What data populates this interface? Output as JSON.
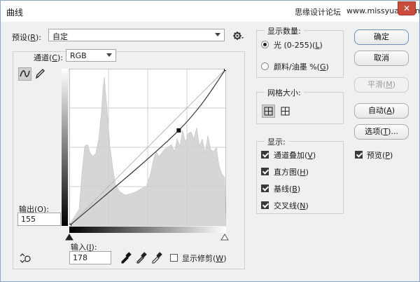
{
  "window": {
    "title": "曲线",
    "close_glyph": "✕"
  },
  "watermark": {
    "site_cn": "思缘设计论坛",
    "site_url": "www.missyuan.com"
  },
  "preset": {
    "label": "预设(",
    "label_key": "R",
    "label_end": "):",
    "value": "自定",
    "gear_icon": "gear-icon"
  },
  "channel": {
    "label": "通道(",
    "label_key": "C",
    "label_end": "):",
    "value": "RGB"
  },
  "output": {
    "label": "输出(",
    "label_key": "O",
    "label_end": "):",
    "value": "155"
  },
  "input": {
    "label": "输入(",
    "label_key": "I",
    "label_end": "):",
    "value": "178"
  },
  "show_clipping": {
    "label": "显示修剪(",
    "label_key": "W",
    "label_end": ")",
    "checked": false
  },
  "show_amount": {
    "title": "显示数量:",
    "options": [
      {
        "label": "光 (0-255)(",
        "key": "L",
        "end": ")",
        "selected": true
      },
      {
        "label": "颜料/油墨 %(",
        "key": "G",
        "end": ")",
        "selected": false
      }
    ]
  },
  "grid_size": {
    "title": "网格大小:"
  },
  "display": {
    "title": "显示:",
    "options": [
      {
        "label": "通道叠加(",
        "key": "V",
        "end": ")",
        "checked": true
      },
      {
        "label": "直方图(",
        "key": "H",
        "end": ")",
        "checked": true
      },
      {
        "label": "基线(",
        "key": "B",
        "end": ")",
        "checked": true
      },
      {
        "label": "交叉线(",
        "key": "N",
        "end": ")",
        "checked": true
      }
    ]
  },
  "buttons": {
    "ok": "确定",
    "cancel": "取消",
    "smooth": "平滑(",
    "smooth_key": "M",
    "smooth_end": ")",
    "auto": "自动(",
    "auto_key": "A",
    "auto_end": ")",
    "options": "选项(",
    "options_key": "T",
    "options_end": ")..."
  },
  "preview": {
    "label": "预览(",
    "key": "P",
    "end": ")",
    "checked": true
  },
  "curve": {
    "input_value": 178,
    "output_value": 155,
    "points": [
      [
        0,
        0
      ],
      [
        178,
        155
      ],
      [
        255,
        255
      ]
    ]
  },
  "colors": {
    "close": "#c84b3c",
    "graph_bg": "#ffffff",
    "histogram": "#d6d6d6",
    "curve": "#333333"
  }
}
